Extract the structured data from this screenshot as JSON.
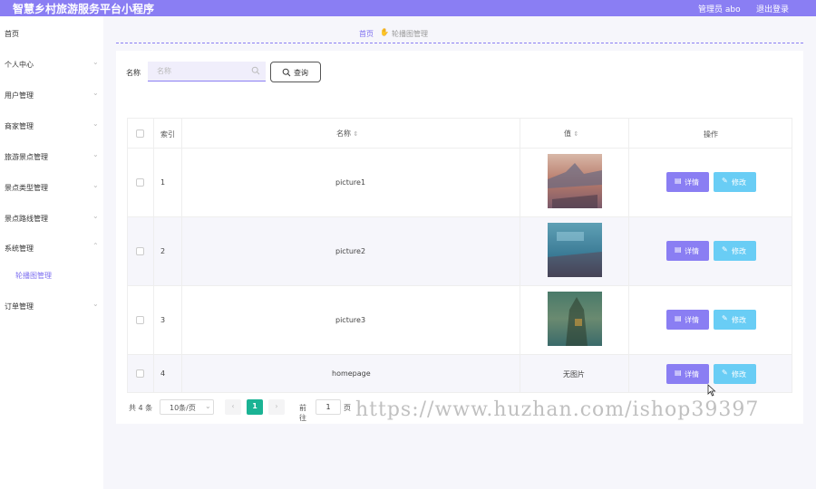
{
  "header": {
    "app_title": "智慧乡村旅游服务平台小程序",
    "admin_label": "管理员 abo",
    "logout_label": "退出登录"
  },
  "sidebar": {
    "items": [
      {
        "label": "首页",
        "has_chevron": false
      },
      {
        "label": "个人中心",
        "has_chevron": true
      },
      {
        "label": "用户管理",
        "has_chevron": true
      },
      {
        "label": "商家管理",
        "has_chevron": true
      },
      {
        "label": "旅游景点管理",
        "has_chevron": true
      },
      {
        "label": "景点类型管理",
        "has_chevron": true
      },
      {
        "label": "景点路线管理",
        "has_chevron": true
      },
      {
        "label": "系统管理",
        "has_chevron": true
      },
      {
        "label": "订单管理",
        "has_chevron": true
      }
    ],
    "sub_items": [
      {
        "label": "轮播图管理",
        "active": true
      }
    ]
  },
  "breadcrumb": {
    "home": "首页",
    "icon": "hand-icon",
    "current": "轮播图管理"
  },
  "filter": {
    "label": "名称",
    "placeholder": "名称",
    "value": "",
    "query_label": "查询"
  },
  "table": {
    "headers": {
      "index": "索引",
      "name": "名称",
      "value": "值",
      "actions": "操作"
    },
    "rows": [
      {
        "index": "1",
        "name": "picture1",
        "value_type": "image",
        "value_text": ""
      },
      {
        "index": "2",
        "name": "picture2",
        "value_type": "image",
        "value_text": ""
      },
      {
        "index": "3",
        "name": "picture3",
        "value_type": "image",
        "value_text": ""
      },
      {
        "index": "4",
        "name": "homepage",
        "value_type": "text",
        "value_text": "无图片"
      }
    ],
    "detail_label": "详情",
    "edit_label": "修改"
  },
  "pagination": {
    "total": "共 4 条",
    "page_size": "10条/页",
    "current_page": "1",
    "goto_label": "前往",
    "goto_value": "1",
    "page_suffix": "页"
  },
  "watermark": "https://www.huzhan.com/ishop39397",
  "colors": {
    "primary": "#8a7ef3",
    "edit": "#69cdf5",
    "page_active": "#1ab394"
  }
}
